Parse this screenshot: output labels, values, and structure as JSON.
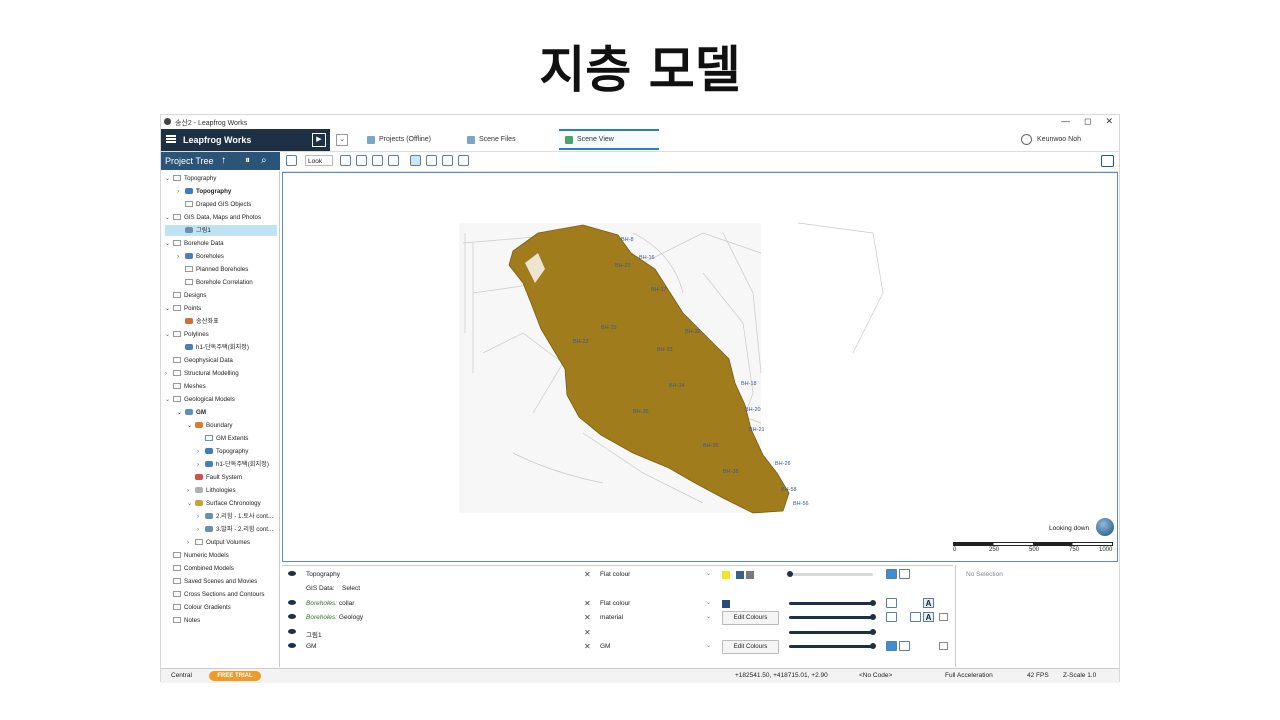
{
  "slide": {
    "title": "지층 모델"
  },
  "window": {
    "title": "송산2 - Leapfrog Works",
    "buttons": [
      "—",
      "◻",
      "✕"
    ]
  },
  "app": {
    "brand": "Leapfrog Works",
    "tabs": [
      {
        "label": "Projects (Offline)"
      },
      {
        "label": "Scene Files"
      },
      {
        "label": "Scene View"
      }
    ],
    "user": "Keunwoo Noh"
  },
  "project_tree": {
    "title": "Project Tree",
    "items": [
      {
        "label": "Topography"
      },
      {
        "label": "Topography"
      },
      {
        "label": "Draped GIS Objects"
      },
      {
        "label": "GIS Data, Maps and Photos"
      },
      {
        "label": "그림1"
      },
      {
        "label": "Borehole Data"
      },
      {
        "label": "Boreholes"
      },
      {
        "label": "Planned Boreholes"
      },
      {
        "label": "Borehole Correlation"
      },
      {
        "label": "Designs"
      },
      {
        "label": "Points"
      },
      {
        "label": "송산좌표"
      },
      {
        "label": "Polylines"
      },
      {
        "label": "h1-단독주택(회지정)"
      },
      {
        "label": "Geophysical Data"
      },
      {
        "label": "Structural Modelling"
      },
      {
        "label": "Meshes"
      },
      {
        "label": "Geological Models"
      },
      {
        "label": "GM"
      },
      {
        "label": "Boundary"
      },
      {
        "label": "GM Extents"
      },
      {
        "label": "Topography"
      },
      {
        "label": "h1-단독주택(회지정)"
      },
      {
        "label": "Fault System"
      },
      {
        "label": "Lithologies"
      },
      {
        "label": "Surface Chronology"
      },
      {
        "label": "2.리힘 - 1.토사 cont..."
      },
      {
        "label": "3.발파 - 2.리힘 cont..."
      },
      {
        "label": "Output Volumes"
      },
      {
        "label": "Numeric Models"
      },
      {
        "label": "Combined Models"
      },
      {
        "label": "Saved Scenes and Movies"
      },
      {
        "label": "Cross Sections and Contours"
      },
      {
        "label": "Colour Gradients"
      },
      {
        "label": "Notes"
      }
    ]
  },
  "scene_toolbar": {
    "look": "Look"
  },
  "scene": {
    "looking": "Looking down",
    "scale_labels": [
      "0",
      "250",
      "500",
      "750",
      "1000"
    ],
    "borehole_labels": [
      "BH-8",
      "BH-16",
      "BH-17",
      "BH-32",
      "BH-18",
      "BH-20",
      "BH-21",
      "BH-26",
      "BH-56",
      "BH-58",
      "BH-23",
      "BH-25",
      "BH-22",
      "BH-33",
      "BH-34",
      "BH-35",
      "BH-36",
      "BH-38"
    ],
    "colors": {
      "model": "#a07c1c",
      "map": "#c9c9c9"
    }
  },
  "shelf": {
    "rows": [
      {
        "name": "Topography",
        "colour": "Flat colour"
      },
      {
        "name": "GIS Data:",
        "colour": "Select"
      },
      {
        "prefix": "Boreholes:",
        "name": "collar",
        "colour": "Flat colour"
      },
      {
        "prefix": "Boreholes:",
        "name": "Geology",
        "colour": "material",
        "button": "Edit Colours"
      },
      {
        "name": "그림1"
      },
      {
        "name": "GM",
        "colour": "GM",
        "button": "Edit Colours"
      }
    ],
    "properties": "No Selection"
  },
  "status": {
    "server": "Central",
    "trial": "FREE TRIAL",
    "coords": "+182541.50, +418715.01, +2.90",
    "code": "<No Code>",
    "accel": "Full Acceleration",
    "fps": "42 FPS",
    "zscale": "Z-Scale 1.0"
  }
}
